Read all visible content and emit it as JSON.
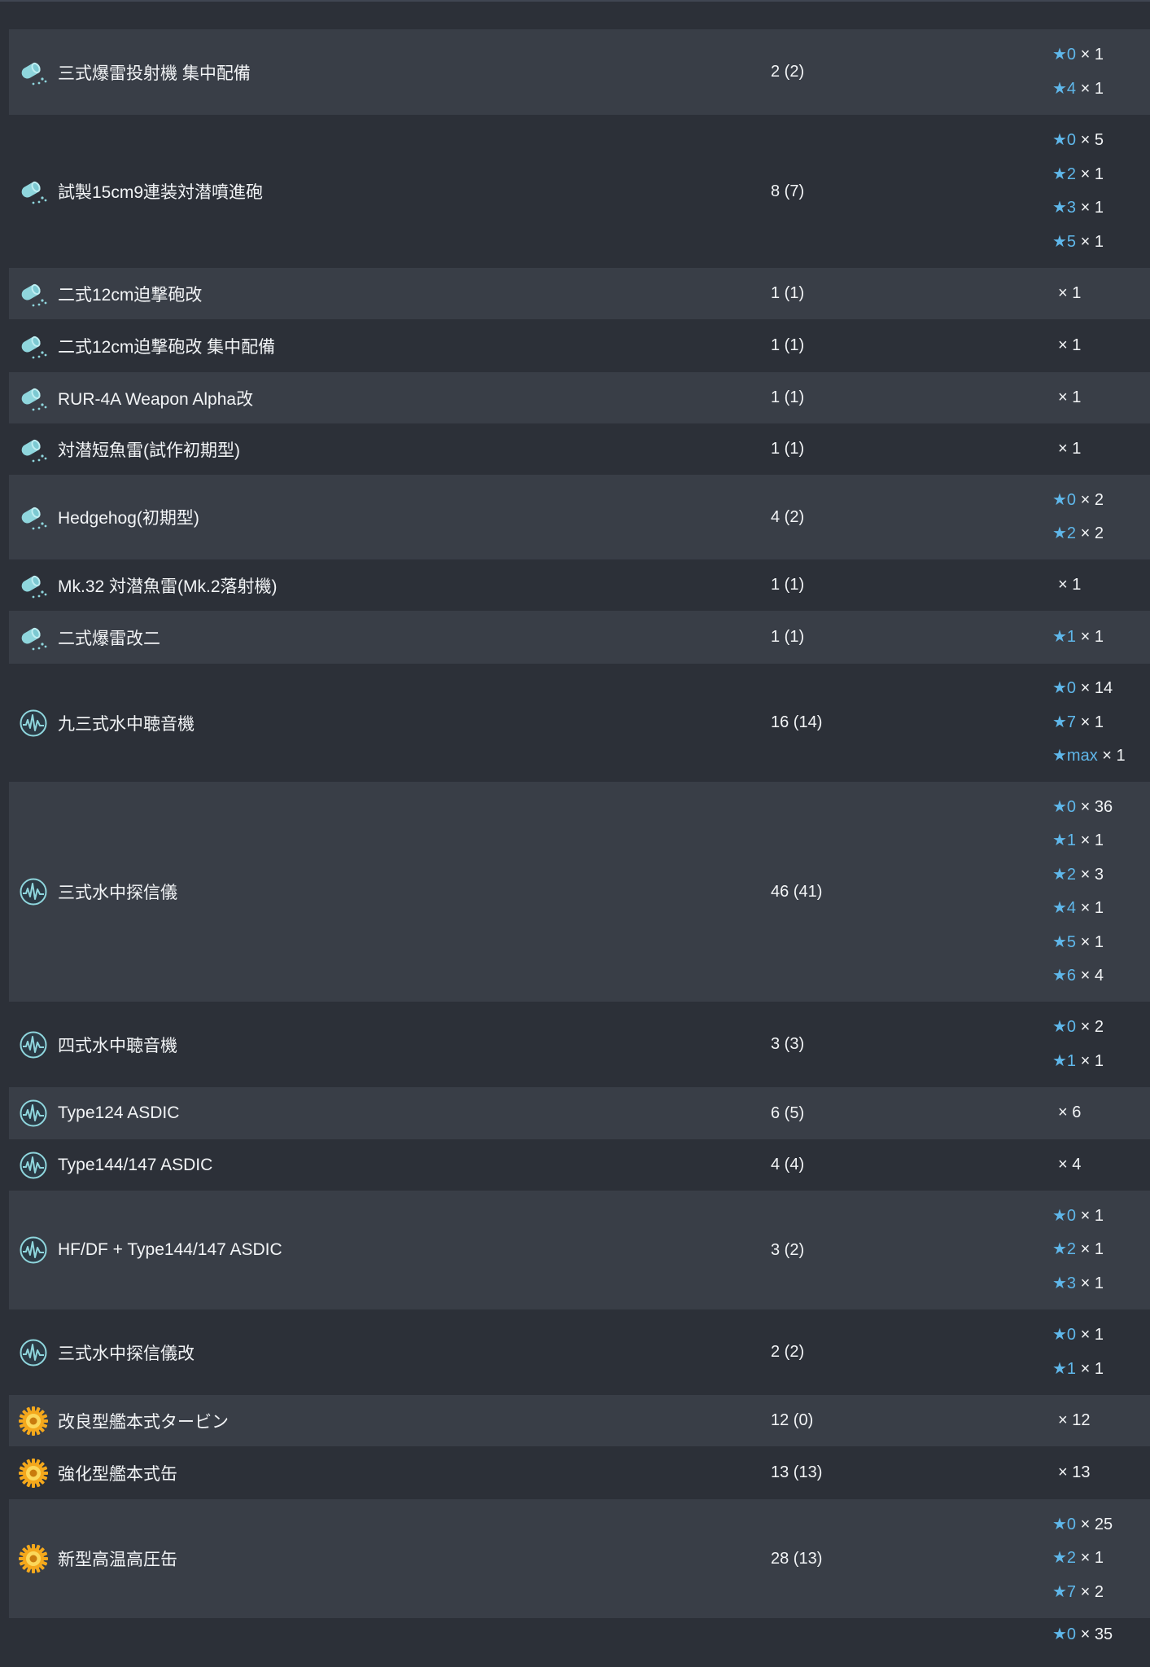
{
  "colors": {
    "background": "#2c3038",
    "row_alt": "#393e47",
    "star_accent": "#5fb7ea",
    "text": "#f2f4f6"
  },
  "rows": [
    {
      "icon": "depth-charge-icon",
      "name": "三式爆雷投射機 集中配備",
      "count": "2 (2)",
      "stars": [
        {
          "level": "★0",
          "qty": "× 1"
        },
        {
          "level": "★4",
          "qty": "× 1"
        }
      ]
    },
    {
      "icon": "depth-charge-icon",
      "name": "試製15cm9連装対潜噴進砲",
      "count": "8 (7)",
      "stars": [
        {
          "level": "★0",
          "qty": "× 5"
        },
        {
          "level": "★2",
          "qty": "× 1"
        },
        {
          "level": "★3",
          "qty": "× 1"
        },
        {
          "level": "★5",
          "qty": "× 1"
        }
      ]
    },
    {
      "icon": "depth-charge-icon",
      "name": "二式12cm迫撃砲改",
      "count": "1 (1)",
      "stars": [
        {
          "level": "",
          "qty": "× 1"
        }
      ]
    },
    {
      "icon": "depth-charge-icon",
      "name": "二式12cm迫撃砲改 集中配備",
      "count": "1 (1)",
      "stars": [
        {
          "level": "",
          "qty": "× 1"
        }
      ]
    },
    {
      "icon": "depth-charge-icon",
      "name": "RUR-4A Weapon Alpha改",
      "count": "1 (1)",
      "stars": [
        {
          "level": "",
          "qty": "× 1"
        }
      ]
    },
    {
      "icon": "depth-charge-icon",
      "name": "対潜短魚雷(試作初期型)",
      "count": "1 (1)",
      "stars": [
        {
          "level": "",
          "qty": "× 1"
        }
      ]
    },
    {
      "icon": "depth-charge-icon",
      "name": "Hedgehog(初期型)",
      "count": "4 (2)",
      "stars": [
        {
          "level": "★0",
          "qty": "× 2"
        },
        {
          "level": "★2",
          "qty": "× 2"
        }
      ]
    },
    {
      "icon": "depth-charge-icon",
      "name": "Mk.32 対潜魚雷(Mk.2落射機)",
      "count": "1 (1)",
      "stars": [
        {
          "level": "",
          "qty": "× 1"
        }
      ]
    },
    {
      "icon": "depth-charge-icon",
      "name": "二式爆雷改二",
      "count": "1 (1)",
      "stars": [
        {
          "level": "★1",
          "qty": "× 1"
        }
      ]
    },
    {
      "icon": "sonar-icon",
      "name": "九三式水中聴音機",
      "count": "16 (14)",
      "stars": [
        {
          "level": "★0",
          "qty": "× 14"
        },
        {
          "level": "★7",
          "qty": "× 1"
        },
        {
          "level": "★max",
          "qty": "× 1"
        }
      ]
    },
    {
      "icon": "sonar-icon",
      "name": "三式水中探信儀",
      "count": "46 (41)",
      "stars": [
        {
          "level": "★0",
          "qty": "× 36"
        },
        {
          "level": "★1",
          "qty": "× 1"
        },
        {
          "level": "★2",
          "qty": "× 3"
        },
        {
          "level": "★4",
          "qty": "× 1"
        },
        {
          "level": "★5",
          "qty": "× 1"
        },
        {
          "level": "★6",
          "qty": "× 4"
        }
      ]
    },
    {
      "icon": "sonar-icon",
      "name": "四式水中聴音機",
      "count": "3 (3)",
      "stars": [
        {
          "level": "★0",
          "qty": "× 2"
        },
        {
          "level": "★1",
          "qty": "× 1"
        }
      ]
    },
    {
      "icon": "sonar-icon",
      "name": "Type124 ASDIC",
      "count": "6 (5)",
      "stars": [
        {
          "level": "",
          "qty": "× 6"
        }
      ]
    },
    {
      "icon": "sonar-icon",
      "name": "Type144/147 ASDIC",
      "count": "4 (4)",
      "stars": [
        {
          "level": "",
          "qty": "× 4"
        }
      ]
    },
    {
      "icon": "sonar-icon",
      "name": "HF/DF + Type144/147 ASDIC",
      "count": "3 (2)",
      "stars": [
        {
          "level": "★0",
          "qty": "× 1"
        },
        {
          "level": "★2",
          "qty": "× 1"
        },
        {
          "level": "★3",
          "qty": "× 1"
        }
      ]
    },
    {
      "icon": "sonar-icon",
      "name": "三式水中探信儀改",
      "count": "2 (2)",
      "stars": [
        {
          "level": "★0",
          "qty": "× 1"
        },
        {
          "level": "★1",
          "qty": "× 1"
        }
      ]
    },
    {
      "icon": "engine-icon",
      "name": "改良型艦本式タービン",
      "count": "12 (0)",
      "stars": [
        {
          "level": "",
          "qty": "× 12"
        }
      ]
    },
    {
      "icon": "engine-icon",
      "name": "強化型艦本式缶",
      "count": "13 (13)",
      "stars": [
        {
          "level": "",
          "qty": "× 13"
        }
      ]
    },
    {
      "icon": "engine-icon",
      "name": "新型高温高圧缶",
      "count": "28 (13)",
      "stars": [
        {
          "level": "★0",
          "qty": "× 25"
        },
        {
          "level": "★2",
          "qty": "× 1"
        },
        {
          "level": "★7",
          "qty": "× 2"
        }
      ]
    },
    {
      "icon": "",
      "name": "",
      "count": "",
      "stars": [
        {
          "level": "★0",
          "qty": "× 35"
        }
      ]
    }
  ]
}
